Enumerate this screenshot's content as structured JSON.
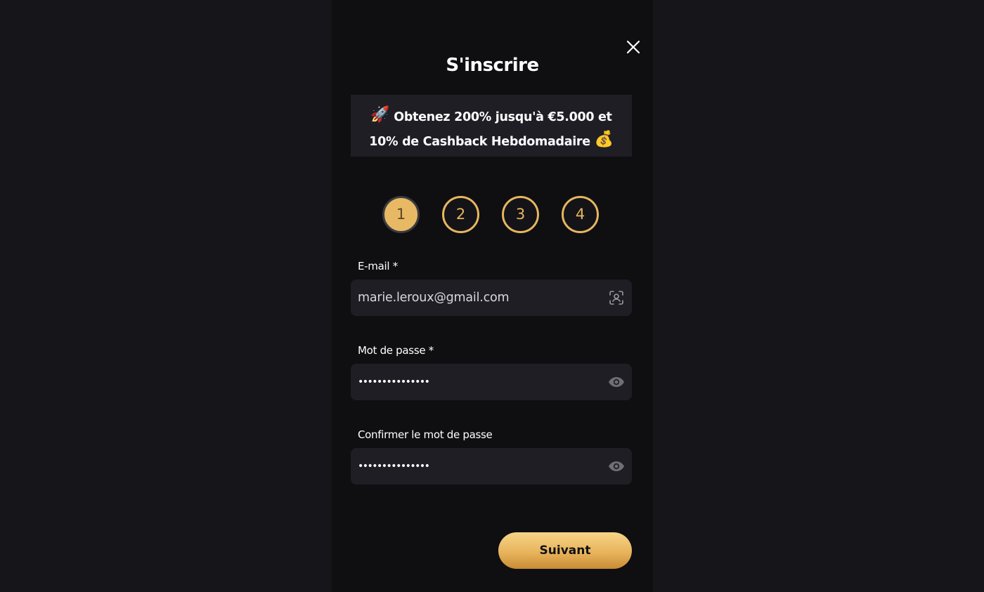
{
  "modal": {
    "title": "S'inscrire",
    "close_icon": "close-icon"
  },
  "promo": {
    "line1_emoji": "🚀",
    "line1_text": " Obtenez 200% jusqu'à €5.000 et",
    "line2_text": "10% de Cashback Hebdomadaire ",
    "line2_emoji": "💰"
  },
  "steps": [
    {
      "label": "1",
      "active": true
    },
    {
      "label": "2",
      "active": false
    },
    {
      "label": "3",
      "active": false
    },
    {
      "label": "4",
      "active": false
    }
  ],
  "form": {
    "email": {
      "label": "E-mail *",
      "value": "marie.leroux@gmail.com",
      "icon": "contact-card-icon"
    },
    "password": {
      "label": "Mot de passe *",
      "value": "•••••••••••••••",
      "icon": "eye-icon"
    },
    "confirm_password": {
      "label": "Confirmer le mot de passe",
      "value": "•••••••••••••••",
      "icon": "eye-icon"
    }
  },
  "actions": {
    "next_label": "Suivant"
  },
  "colors": {
    "page_bg": "#16161a",
    "modal_bg": "#0f0f11",
    "field_bg": "#1f1e25",
    "accent_gold": "#e8b964"
  }
}
